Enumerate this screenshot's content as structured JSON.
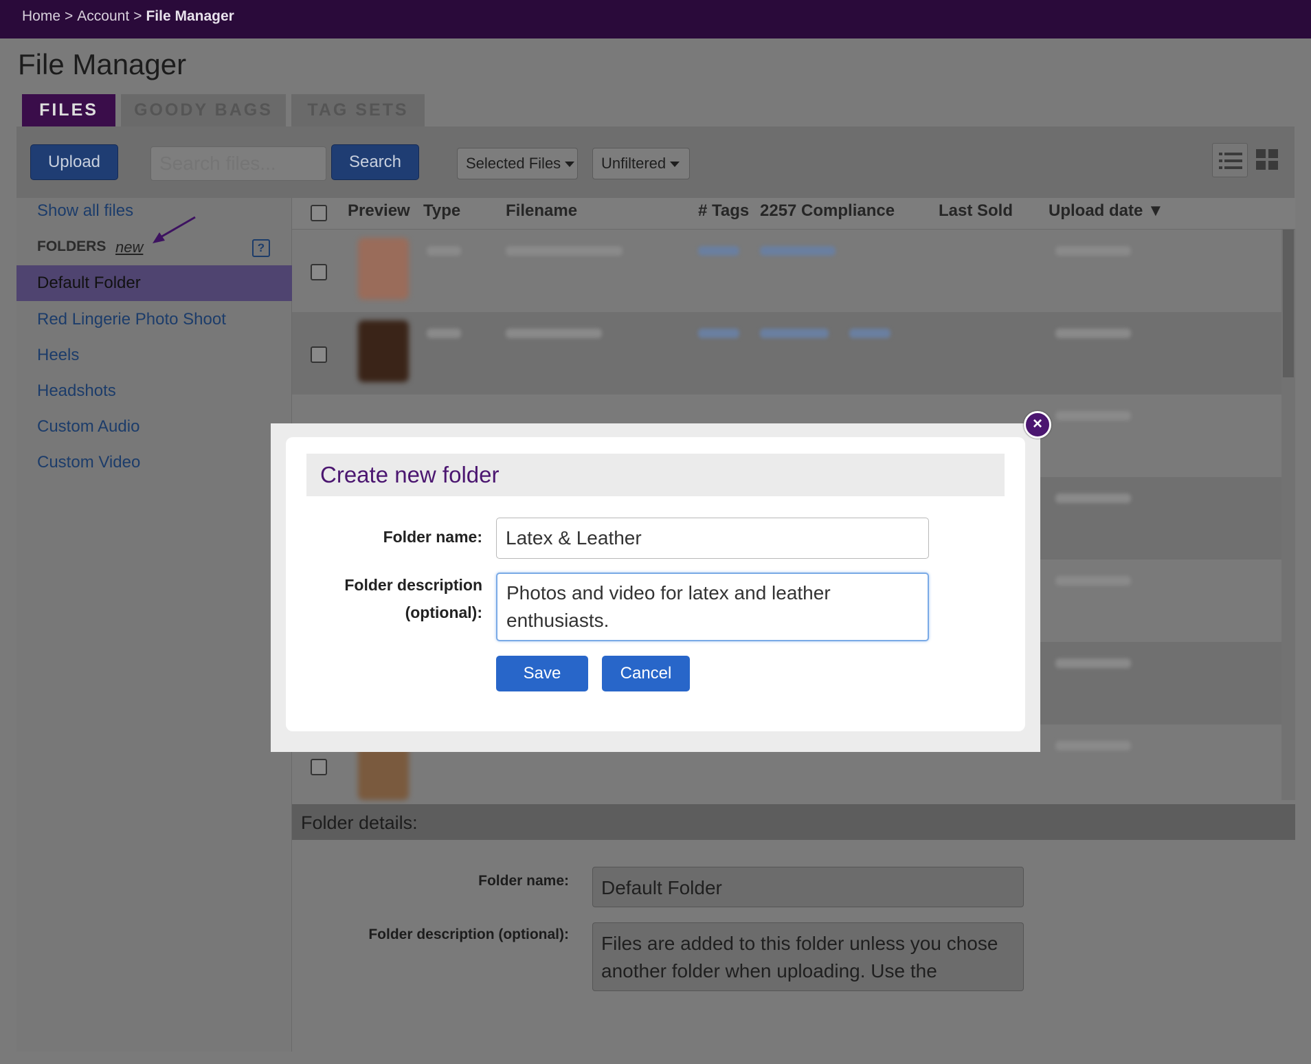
{
  "breadcrumb": {
    "home": "Home",
    "account": "Account",
    "current": "File Manager",
    "separator": ">"
  },
  "page_title": "File Manager",
  "tabs": [
    {
      "label": "FILES",
      "active": true
    },
    {
      "label": "GOODY BAGS",
      "active": false
    },
    {
      "label": "TAG SETS",
      "active": false
    }
  ],
  "toolbar": {
    "upload_label": "Upload",
    "search_placeholder": "Search files...",
    "search_label": "Search",
    "selected_files_label": "Selected Files",
    "filter_label": "Unfiltered",
    "list_view_icon": "list-view-icon",
    "grid_view_icon": "grid-view-icon"
  },
  "sidebar": {
    "show_all": "Show all files",
    "folders_label": "FOLDERS",
    "new_label": "new",
    "help_label": "?",
    "folders": [
      {
        "label": "Default Folder",
        "active": true
      },
      {
        "label": "Red Lingerie Photo Shoot",
        "active": false
      },
      {
        "label": "Heels",
        "active": false
      },
      {
        "label": "Headshots",
        "active": false
      },
      {
        "label": "Custom Audio",
        "active": false
      },
      {
        "label": "Custom Video",
        "active": false
      }
    ]
  },
  "table": {
    "columns": [
      "Preview",
      "Type",
      "Filename",
      "# Tags",
      "2257 Compliance",
      "Last Sold",
      "Upload date"
    ],
    "sort_indicator": "▼"
  },
  "folder_details": {
    "heading": "Folder details:",
    "name_label": "Folder name:",
    "name_value": "Default Folder",
    "desc_label": "Folder description (optional):",
    "desc_value": "Files are added to this folder unless you chose another folder when uploading. Use the"
  },
  "modal": {
    "title": "Create new folder",
    "name_label": "Folder name:",
    "name_value": "Latex & Leather",
    "desc_label_line1": "Folder description",
    "desc_label_line2": "(optional):",
    "desc_value": "Photos and video for latex and leather enthusiasts.",
    "save_label": "Save",
    "cancel_label": "Cancel",
    "close_glyph": "×"
  },
  "colors": {
    "brand_purple": "#4b1670",
    "topbar": "#2a0a3a",
    "primary_blue": "#2866c9",
    "link_blue": "#1c3c6a"
  }
}
